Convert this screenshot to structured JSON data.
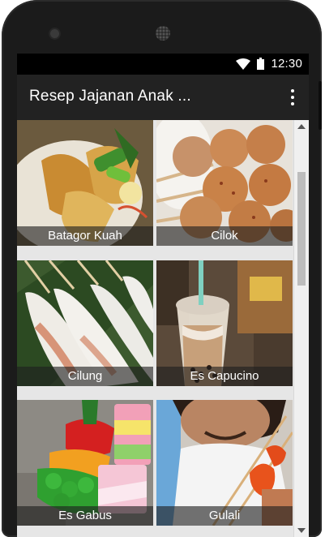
{
  "status_bar": {
    "time": "12:30",
    "icons": [
      "wifi-icon",
      "battery-icon"
    ]
  },
  "app_bar": {
    "title": "Resep Jajanan Anak ...",
    "menu_icon": "overflow-menu-icon"
  },
  "items": [
    {
      "label": "Batagor Kuah"
    },
    {
      "label": "Cilok"
    },
    {
      "label": "Cilung"
    },
    {
      "label": "Es Capucino"
    },
    {
      "label": "Es Gabus"
    },
    {
      "label": "Gulali"
    }
  ],
  "colors": {
    "app_bar": "#222222",
    "status_bar": "#000000",
    "label_overlay": "#1e1e1e"
  }
}
